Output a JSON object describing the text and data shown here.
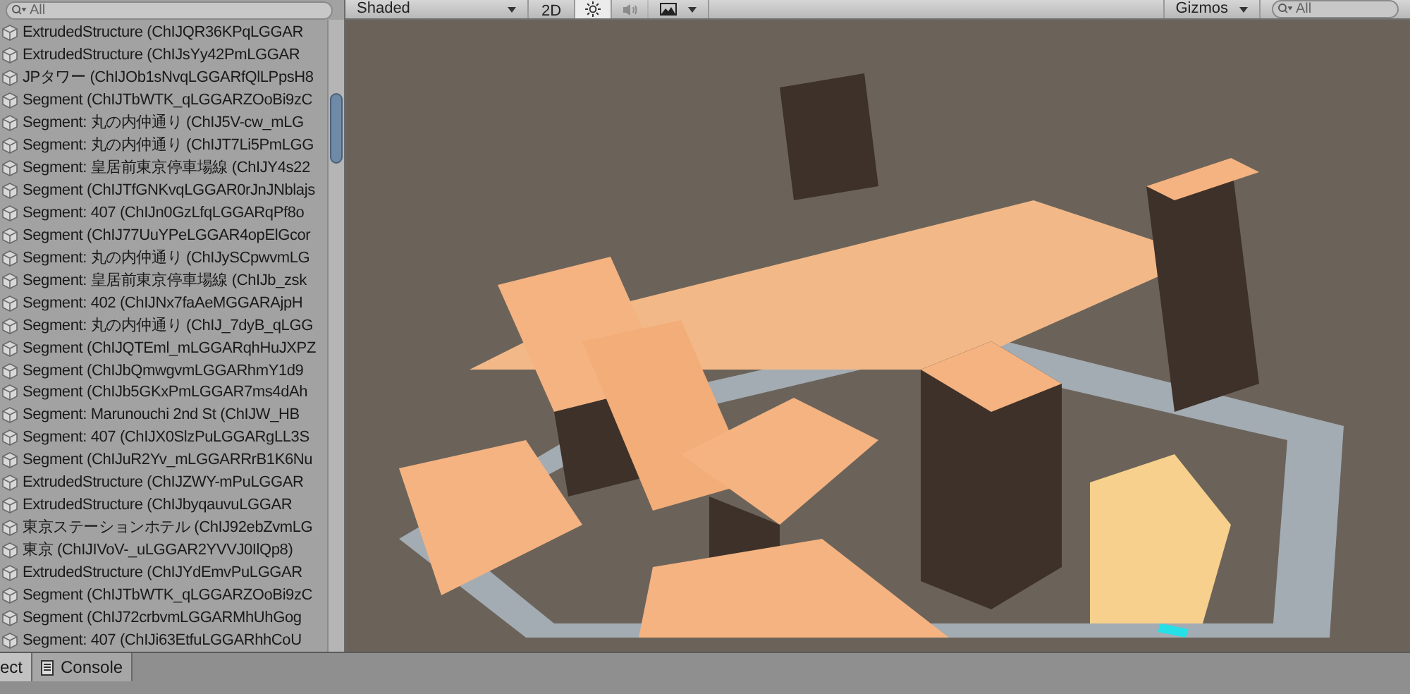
{
  "hierarchy": {
    "search": {
      "placeholder": "All"
    },
    "rows": [
      {
        "label": "ExtrudedStructure (ChIJQR36KPqLGGAR"
      },
      {
        "label": "ExtrudedStructure (ChIJsYy42PmLGGAR"
      },
      {
        "label": "JPタワー (ChIJOb1sNvqLGGARfQlLPpsH8"
      },
      {
        "label": "Segment (ChIJTbWTK_qLGGARZOoBi9zC"
      },
      {
        "label": "Segment: 丸の内仲通り (ChIJ5V-cw_mLG"
      },
      {
        "label": "Segment: 丸の内仲通り (ChIJT7Li5PmLGG"
      },
      {
        "label": "Segment: 皇居前東京停車場線 (ChIJY4s22"
      },
      {
        "label": "Segment (ChIJTfGNKvqLGGAR0rJnJNblajs"
      },
      {
        "label": "Segment: 407 (ChIJn0GzLfqLGGARqPf8o"
      },
      {
        "label": "Segment (ChIJ77UuYPeLGGAR4opElGcor"
      },
      {
        "label": "Segment: 丸の内仲通り (ChIJySCpwvmLG"
      },
      {
        "label": "Segment: 皇居前東京停車場線 (ChIJb_zsk"
      },
      {
        "label": "Segment: 402 (ChIJNx7faAeMGGARAjpH"
      },
      {
        "label": "Segment: 丸の内仲通り (ChIJ_7dyB_qLGG"
      },
      {
        "label": "Segment (ChIJQTEml_mLGGARqhHuJXPZ"
      },
      {
        "label": "Segment (ChIJbQmwgvmLGGARhmY1d9"
      },
      {
        "label": "Segment (ChIJb5GKxPmLGGAR7ms4dAh"
      },
      {
        "label": "Segment: Marunouchi 2nd St (ChIJW_HB"
      },
      {
        "label": "Segment: 407 (ChIJX0SlzPuLGGARgLL3S"
      },
      {
        "label": "Segment (ChIJuR2Yv_mLGGARRrB1K6Nu"
      },
      {
        "label": "ExtrudedStructure (ChIJZWY-mPuLGGAR"
      },
      {
        "label": "ExtrudedStructure (ChIJbyqauvuLGGAR"
      },
      {
        "label": "東京ステーションホテル (ChIJ92ebZvmLG"
      },
      {
        "label": "東京 (ChIJIVoV-_uLGGAR2YVVJ0IlQp8)"
      },
      {
        "label": "ExtrudedStructure (ChIJYdEmvPuLGGAR"
      },
      {
        "label": "Segment (ChIJTbWTK_qLGGARZOoBi9zC"
      },
      {
        "label": "Segment (ChIJ72crbvmLGGARMhUhGog"
      },
      {
        "label": "Segment: 407 (ChIJi63EtfuLGGARhhCoU"
      }
    ]
  },
  "scene_toolbar": {
    "draw_mode": "Shaded",
    "mode_2d": "2D",
    "lighting_on": true,
    "audio_on": false,
    "gizmos": "Gizmos",
    "search": {
      "placeholder": "All"
    }
  },
  "bottom_tabs": [
    {
      "label": "ect",
      "selected": true
    },
    {
      "label": "Console",
      "selected": false
    }
  ]
}
